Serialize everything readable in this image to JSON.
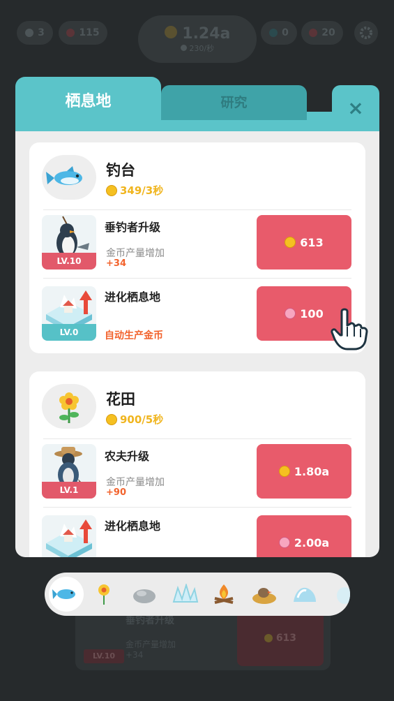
{
  "background": {
    "topbar": {
      "left_stat": "3",
      "gems": "115",
      "coins": "1.24a",
      "coins_rate": "230/秒",
      "fish": "0",
      "hearts": "20"
    },
    "behind_card": {
      "level": "LV.10",
      "title": "垂钓者升级",
      "subtitle": "金币产量增加",
      "plus": "+34",
      "price": "613"
    }
  },
  "tabs": {
    "active": "栖息地",
    "inactive": "研究",
    "close": "×"
  },
  "habitats": [
    {
      "title": "钓台",
      "rate": "349/3秒",
      "rows": [
        {
          "title": "垂钓者升级",
          "level": "LV.10",
          "subtitle": "金币产量增加",
          "plus": "+34",
          "price": "613",
          "currency": "coin"
        },
        {
          "title": "进化栖息地",
          "level": "LV.0",
          "note": "自动生产金币",
          "price": "100",
          "currency": "heart"
        }
      ]
    },
    {
      "title": "花田",
      "rate": "900/5秒",
      "rows": [
        {
          "title": "农夫升级",
          "level": "LV.1",
          "subtitle": "金币产量增加",
          "plus": "+90",
          "price": "1.80a",
          "currency": "coin"
        },
        {
          "title": "进化栖息地",
          "level": "",
          "price": "2.00a",
          "currency": "heart"
        }
      ]
    }
  ],
  "selector": [
    "fish-icon",
    "flower-icon",
    "rock-icon",
    "ice-icon",
    "campfire-icon",
    "nest-icon",
    "iceberg-icon",
    "egg-icon"
  ],
  "colors": {
    "teal": "#5bc4c9",
    "button": "#e85b6b",
    "coin": "#f5c021",
    "orange": "#f2632d"
  }
}
